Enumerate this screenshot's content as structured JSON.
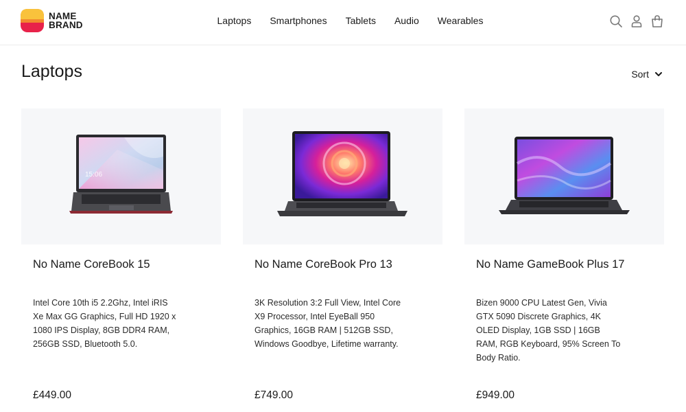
{
  "brand": {
    "line1": "NAME",
    "line2": "BRAND"
  },
  "nav": [
    "Laptops",
    "Smartphones",
    "Tablets",
    "Audio",
    "Wearables"
  ],
  "header_icons": [
    "search-icon",
    "account-icon",
    "cart-bag-icon"
  ],
  "page": {
    "title": "Laptops",
    "sort_label": "Sort"
  },
  "products": [
    {
      "name": "No Name CoreBook 15",
      "description": "Intel Core 10th i5 2.2Ghz, Intel iRIS Xe Max GG Graphics, Full HD 1920 x 1080 IPS Display, 8GB DDR4 RAM, 256GB SSD, Bluetooth 5.0.",
      "price": "£449.00",
      "screen_clock": "15:06"
    },
    {
      "name": "No Name CoreBook Pro 13",
      "description": "3K Resolution 3:2 Full View, Intel Core X9 Processor, Intel EyeBall 950 Graphics, 16GB RAM | 512GB SSD, Windows Goodbye, Lifetime warranty.",
      "price": "£749.00"
    },
    {
      "name": "No Name GameBook Plus 17",
      "description": "Bizen 9000 CPU Latest Gen, Vivia GTX 5090 Discrete Graphics, 4K OLED Display, 1GB SSD | 16GB RAM, RGB Keyboard, 95% Screen To Body Ratio.",
      "price": "£949.00"
    }
  ],
  "colors": {
    "logo_top": "#f9c23c",
    "logo_bottom": "#e8224a",
    "image_bg": "#f6f7f9",
    "text": "#1a1a1a"
  }
}
